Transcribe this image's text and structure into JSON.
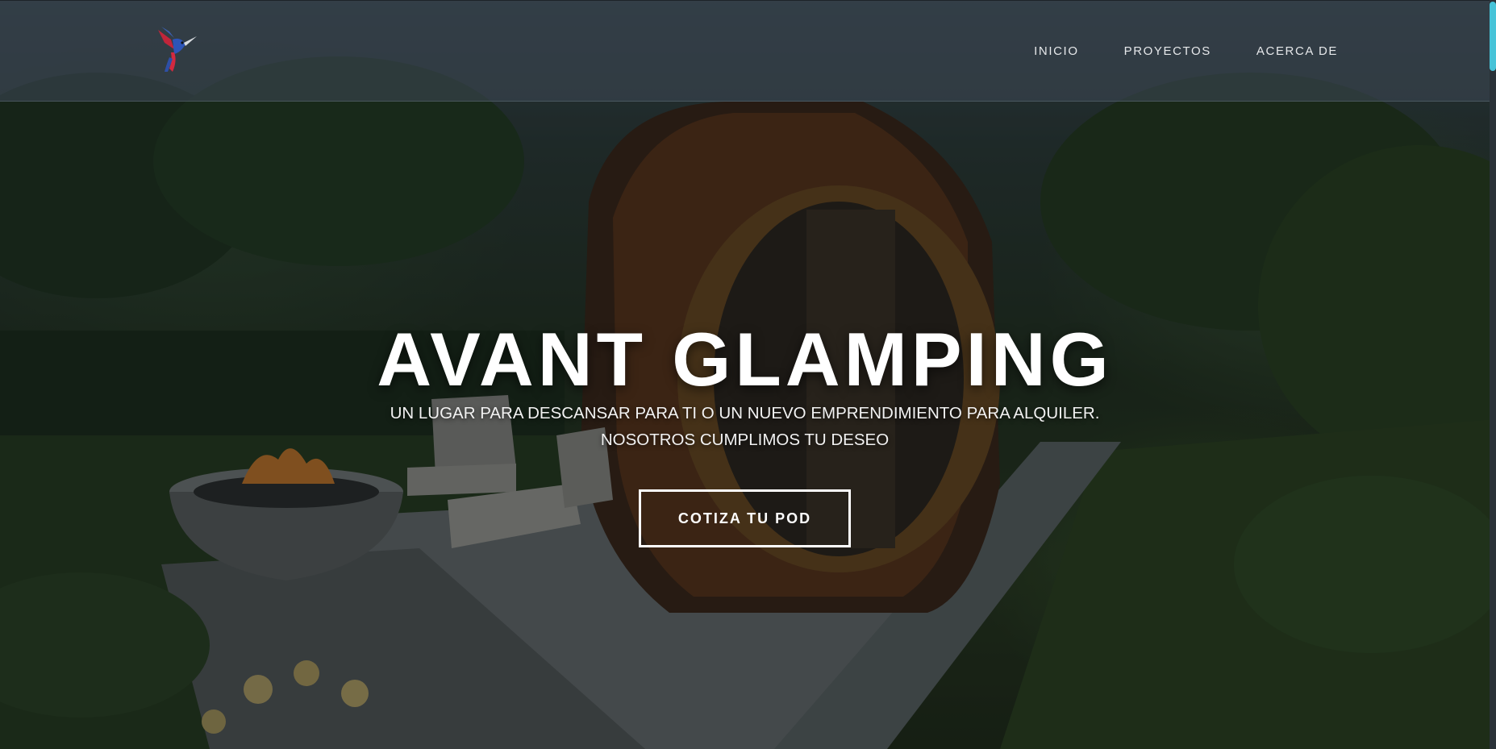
{
  "nav": {
    "items": [
      {
        "label": "INICIO"
      },
      {
        "label": "PROYECTOS"
      },
      {
        "label": "ACERCA DE"
      }
    ]
  },
  "hero": {
    "title": "AVANT GLAMPING",
    "subtitle_line1": "UN LUGAR PARA DESCANSAR PARA TI O UN NUEVO EMPRENDIMIENTO PARA ALQUILER.",
    "subtitle_line2": "NOSOTROS CUMPLIMOS TU DESEO",
    "cta_label": "COTIZA TU POD"
  },
  "colors": {
    "accent_scrollbar": "#47c3d8",
    "header_bg": "#3a4650",
    "text": "#ffffff"
  },
  "icons": {
    "logo": "hummingbird-logo-icon"
  }
}
